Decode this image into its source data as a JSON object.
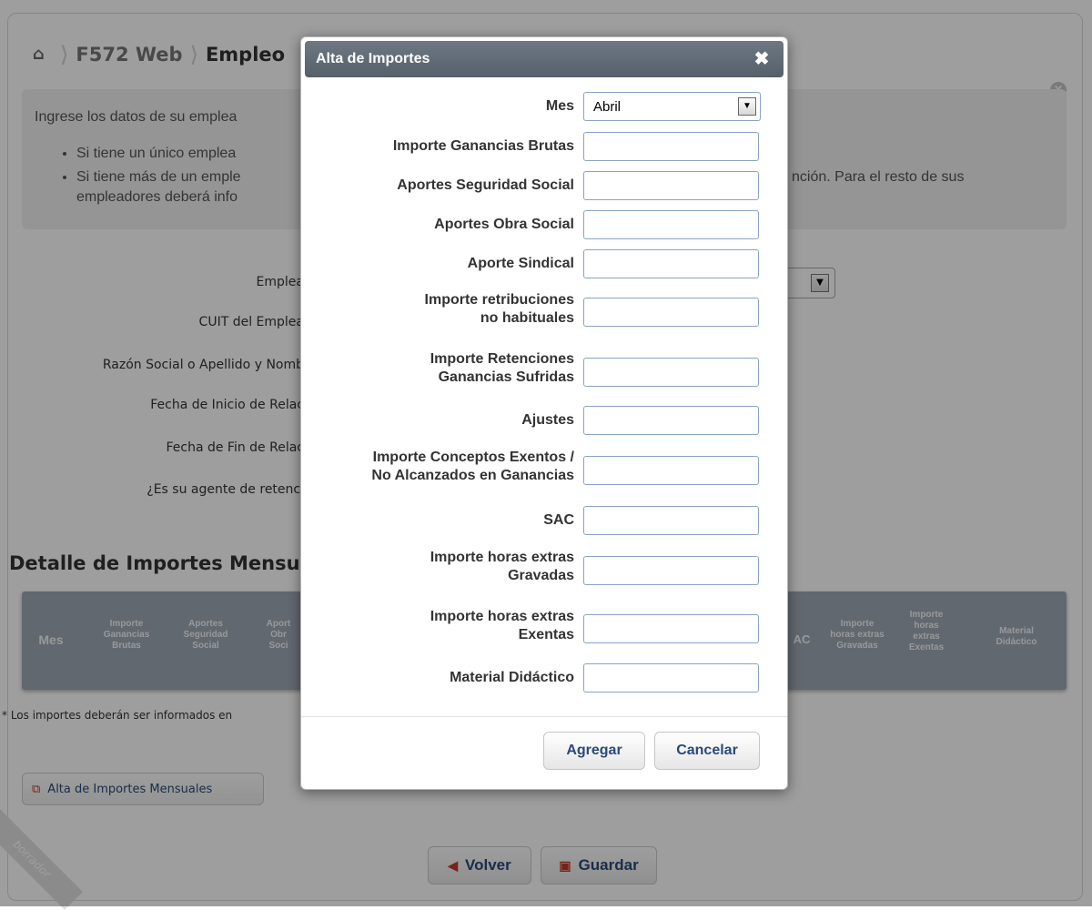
{
  "breadcrumb": {
    "home_icon": "home-icon",
    "item1": "F572 Web",
    "item2": "Empleo"
  },
  "info": {
    "intro": "Ingrese los datos de su emplea",
    "bullet1": "Si tiene un único emplea",
    "bullet2a": "Si tiene más de un emple",
    "bullet2b": "empleadores deberá info",
    "bullet2_right": "nción. Para el resto de sus"
  },
  "form_labels": {
    "empleador": "Emplea",
    "cuit": "CUIT del Emplea",
    "razon": "Razón Social o Apellido y Nomb",
    "inicio": "Fecha de Inicio de Relac",
    "fin": "Fecha de Fin de Relac",
    "agente": "¿Es su agente de retenci"
  },
  "section_title": "Detalle de Importes Mensuale",
  "table_headers": {
    "mes": "Mes",
    "ganancias": [
      "Importe",
      "Ganancias",
      "Brutas"
    ],
    "seguridad": [
      "Aportes",
      "Seguridad",
      "Social"
    ],
    "obra": [
      "Aport",
      "Obr",
      "Soci"
    ],
    "sac": "AC",
    "hs_gravadas": [
      "Importe",
      "horas extras",
      "Gravadas"
    ],
    "hs_exentas": [
      "Importe",
      "horas",
      "extras",
      "Exentas"
    ],
    "material": [
      "Material",
      "Didáctico"
    ]
  },
  "footnote": "* Los importes deberán ser informados en",
  "alta_button": "Alta de Importes Mensuales",
  "ribbon": "borrador",
  "bottom_buttons": {
    "volver": "Volver",
    "guardar": "Guardar"
  },
  "modal": {
    "title": "Alta de Importes",
    "mes_label": "Mes",
    "mes_value": "Abril",
    "fields": {
      "ganancias_brutas": "Importe Ganancias Brutas",
      "seguridad_social": "Aportes Seguridad Social",
      "obra_social": "Aportes Obra Social",
      "sindical": "Aporte Sindical",
      "no_habituales_1": "Importe retribuciones",
      "no_habituales_2": "no habituales",
      "retenciones_1": "Importe Retenciones",
      "retenciones_2": "Ganancias Sufridas",
      "ajustes": "Ajustes",
      "exentos_1": "Importe Conceptos Exentos /",
      "exentos_2": "No Alcanzados en Ganancias",
      "sac": "SAC",
      "hs_gravadas_1": "Importe horas extras",
      "hs_gravadas_2": "Gravadas",
      "hs_exentas_1": "Importe horas extras",
      "hs_exentas_2": "Exentas",
      "material": "Material Didáctico"
    },
    "agregar": "Agregar",
    "cancelar": "Cancelar"
  }
}
